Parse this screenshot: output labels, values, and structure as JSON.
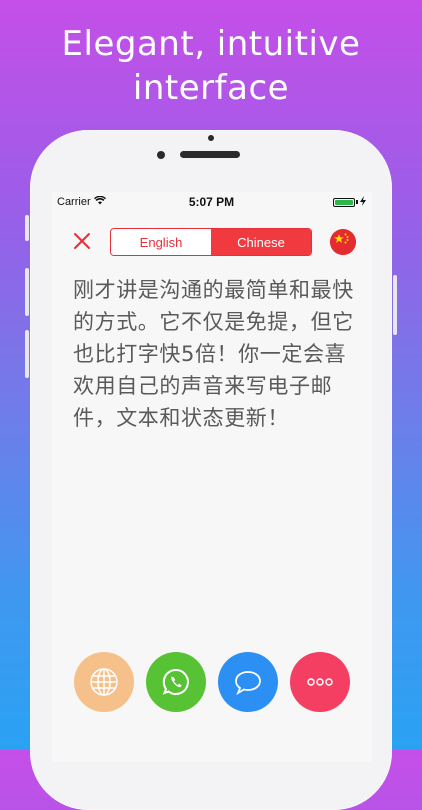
{
  "headline": {
    "line1": "Elegant, intuitive",
    "line2": "interface"
  },
  "status_bar": {
    "carrier": "Carrier",
    "time": "5:07 PM"
  },
  "toolbar": {
    "language_tabs": [
      {
        "label": "English",
        "selected": false
      },
      {
        "label": "Chinese",
        "selected": true
      }
    ],
    "close_icon": "close-x-icon",
    "flag_icon": "china-flag-icon"
  },
  "content": {
    "text": "刚才讲是沟通的最简单和最快的方式。它不仅是免提，但它也比打字快5倍！你一定会喜欢用自己的声音来写电子邮件，文本和状态更新！"
  },
  "actions": [
    {
      "icon": "globe-icon",
      "color": "#f5c08a"
    },
    {
      "icon": "whatsapp-icon",
      "color": "#57c234"
    },
    {
      "icon": "chat-bubble-icon",
      "color": "#2b8ff3"
    },
    {
      "icon": "more-icon",
      "color": "#f43f63"
    }
  ],
  "colors": {
    "accent": "#e8303a",
    "text": "#5a5a5a"
  }
}
